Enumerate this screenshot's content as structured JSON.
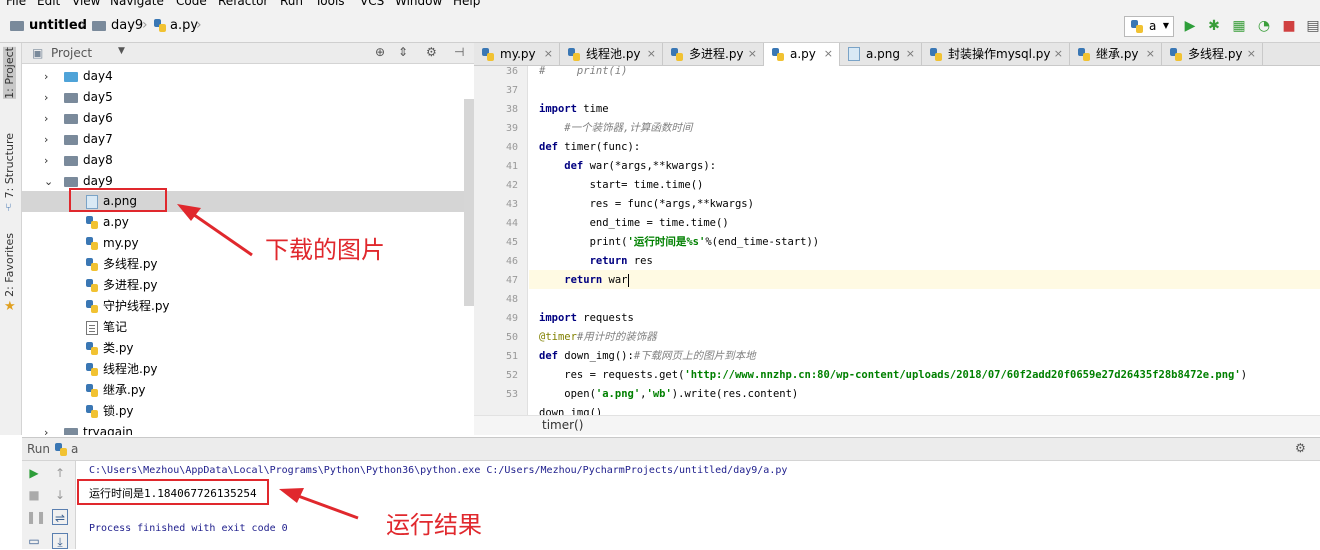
{
  "menu": [
    "File",
    "Edit",
    "View",
    "Navigate",
    "Code",
    "Refactor",
    "Run",
    "Tools",
    "VCS",
    "Window",
    "Help"
  ],
  "navbar": {
    "project": "untitled",
    "folder": "day9",
    "file": "a.py",
    "run_config": "a"
  },
  "left_tabs": {
    "project": "1: Project",
    "structure": "7: Structure",
    "favorites": "2: Favorites"
  },
  "project_panel": {
    "title": "Project"
  },
  "tree": [
    {
      "label": "day4",
      "kind": "folder",
      "arrow": "›",
      "color": "blue"
    },
    {
      "label": "day5",
      "kind": "folder",
      "arrow": "›"
    },
    {
      "label": "day6",
      "kind": "folder",
      "arrow": "›"
    },
    {
      "label": "day7",
      "kind": "folder",
      "arrow": "›"
    },
    {
      "label": "day8",
      "kind": "folder",
      "arrow": "›"
    },
    {
      "label": "day9",
      "kind": "folder",
      "arrow": "⌄"
    },
    {
      "label": "a.png",
      "kind": "png",
      "selected": true
    },
    {
      "label": "a.py",
      "kind": "py"
    },
    {
      "label": "my.py",
      "kind": "py"
    },
    {
      "label": "多线程.py",
      "kind": "py"
    },
    {
      "label": "多进程.py",
      "kind": "py"
    },
    {
      "label": "守护线程.py",
      "kind": "py"
    },
    {
      "label": "笔记",
      "kind": "txt"
    },
    {
      "label": "类.py",
      "kind": "py"
    },
    {
      "label": "线程池.py",
      "kind": "py"
    },
    {
      "label": "继承.py",
      "kind": "py"
    },
    {
      "label": "锁.py",
      "kind": "py"
    },
    {
      "label": "tryagain",
      "kind": "folder",
      "arrow": "›"
    }
  ],
  "tabs": [
    "my.py",
    "线程池.py",
    "多进程.py",
    "a.py",
    "a.png",
    "封装操作mysql.py",
    "继承.py",
    "多线程.py"
  ],
  "active_tab": "a.py",
  "line_numbers": [
    "36",
    "37",
    "38",
    "39",
    "40",
    "41",
    "42",
    "43",
    "44",
    "45",
    "46",
    "47",
    "48",
    "49",
    "50",
    "51",
    "52",
    "53"
  ],
  "code": {
    "l36": "#     print(i)",
    "l38_kw": "import",
    "l38_rest": " time",
    "l39": "    #一个装饰器,计算函数时间",
    "l40_kw": "def",
    "l40_rest": " timer(func):",
    "l41_kw": "    def",
    "l41_rest": " war(*args,**kwargs):",
    "l42": "        start= time.time()",
    "l43": "        res = func(*args,**kwargs)",
    "l44": "        end_time = time.time()",
    "l45_a": "        print(",
    "l45_str": "'运行时间是%s'",
    "l45_b": "%(end_time-start))",
    "l46_kw": "        return",
    "l46_rest": " res",
    "l47_kw": "    return",
    "l47_rest": " war",
    "l49_kw": "import",
    "l49_rest": " requests",
    "l50_dec": "@timer",
    "l50_cm": "#用计时的装饰器",
    "l51_kw": "def",
    "l51_rest": " down_img():",
    "l51_cm": "#下载网页上的图片到本地",
    "l52_a": "    res = requests.get(",
    "l52_str": "'http://www.nnzhp.cn:80/wp-content/uploads/2018/07/60f2add20f0659e27d26435f28b8472e.png'",
    "l52_b": ")",
    "l53_a": "    open(",
    "l53_str1": "'a.png'",
    "l53_c": ",",
    "l53_str2": "'wb'",
    "l53_b": ").write(res.content)",
    "l54": "down_img()"
  },
  "editor_breadcrumb": "timer()",
  "run_panel": {
    "label": "Run",
    "config": "a"
  },
  "console": {
    "cmd": "C:\\Users\\Mezhou\\AppData\\Local\\Programs\\Python\\Python36\\python.exe C:/Users/Mezhou/PycharmProjects/untitled/day9/a.py",
    "result": "运行时间是1.184067726135254",
    "exit": "Process finished with exit code 0"
  },
  "annotations": {
    "download": "下载的图片",
    "result": "运行结果"
  },
  "colors": {
    "annotation": "#e0282d",
    "keyword": "#000080",
    "string": "#008000"
  }
}
